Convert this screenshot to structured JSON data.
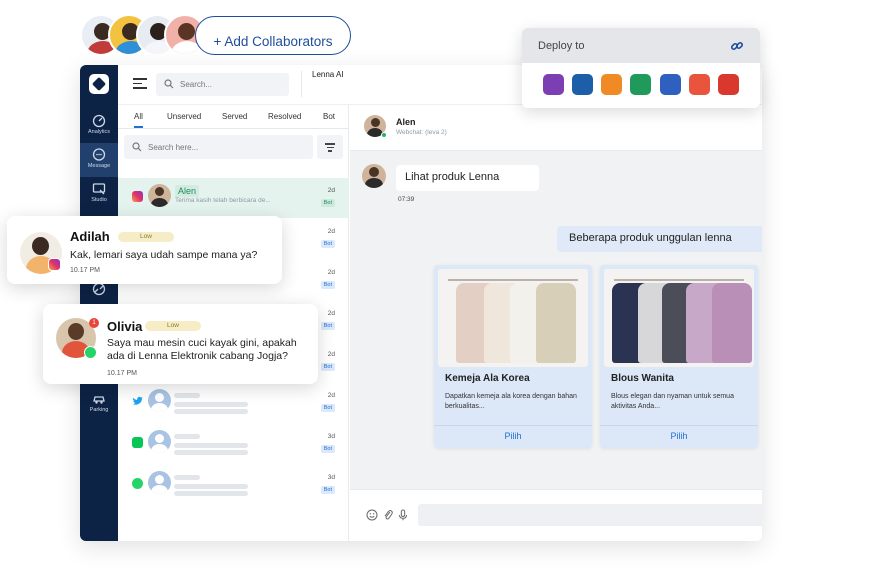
{
  "collaborators": {
    "add_label": "+ Add Collaborators"
  },
  "deploy": {
    "title": "Deploy to",
    "channels": [
      {
        "icon": "messenger-icon",
        "color": "#7b3fb3"
      },
      {
        "icon": "sync-icon",
        "color": "#1d5ea8"
      },
      {
        "icon": "home-icon",
        "color": "#f08a24"
      },
      {
        "icon": "chat-icon",
        "color": "#1f9a5a"
      },
      {
        "icon": "plugin-icon",
        "color": "#2f5fbf"
      },
      {
        "icon": "play-icon",
        "color": "#e8553c"
      },
      {
        "icon": "kiosk-icon",
        "color": "#d8382e"
      }
    ]
  },
  "sidebar": {
    "items": [
      {
        "label": "Analytics",
        "icon": "analytics-icon"
      },
      {
        "label": "Message",
        "icon": "message-icon"
      },
      {
        "label": "Studio",
        "icon": "studio-icon"
      },
      {
        "label": "Parking",
        "icon": "car-icon"
      }
    ]
  },
  "topbar": {
    "search_placeholder": "Search...",
    "brand": "Lenna AI"
  },
  "list": {
    "tabs": [
      "All",
      "Unserved",
      "Served",
      "Resolved",
      "Bot"
    ],
    "search_placeholder": "Search here...",
    "conversations": [
      {
        "name": "Alen",
        "preview": "Terima kasih telah berbicara de...",
        "age": "2d",
        "tag": "Bot",
        "channel": "instagram"
      },
      {
        "age": "2d",
        "tag": "Bot"
      },
      {
        "age": "2d",
        "tag": "Bot"
      },
      {
        "age": "2d",
        "tag": "Bot"
      },
      {
        "age": "2d",
        "tag": "Bot"
      },
      {
        "age": "2d",
        "tag": "Bot",
        "channel": "twitter"
      },
      {
        "age": "3d",
        "tag": "Bot",
        "channel": "line"
      },
      {
        "age": "3d",
        "tag": "Bot",
        "channel": "whatsapp"
      }
    ]
  },
  "chat": {
    "contact_name": "Alen",
    "contact_sub": "Webchat: (leva 2)",
    "incoming": "Lihat produk Lenna",
    "incoming_time": "07:39",
    "outgoing": "Beberapa produk unggulan lenna",
    "cards": [
      {
        "title": "Kemeja Ala Korea",
        "desc": "Dapatkan kemeja ala korea dengan bahan berkualitas...",
        "button": "Pilih"
      },
      {
        "title": "Blous Wanita",
        "desc": "Blous elegan dan nyaman untuk semua aktivitas Anda...",
        "button": "Pilih"
      }
    ]
  },
  "notifications": [
    {
      "name": "Adilah",
      "priority": "Low",
      "text": "Kak, lemari saya udah sampe mana ya?",
      "time": "10.17 PM",
      "channel": "instagram"
    },
    {
      "name": "Olivia",
      "priority": "Low",
      "text": "Saya mau mesin cuci kayak gini, apakah ada di Lenna Elektronik cabang Jogja?",
      "time": "10.17 PM",
      "channel": "whatsapp",
      "unread": "1"
    }
  ]
}
